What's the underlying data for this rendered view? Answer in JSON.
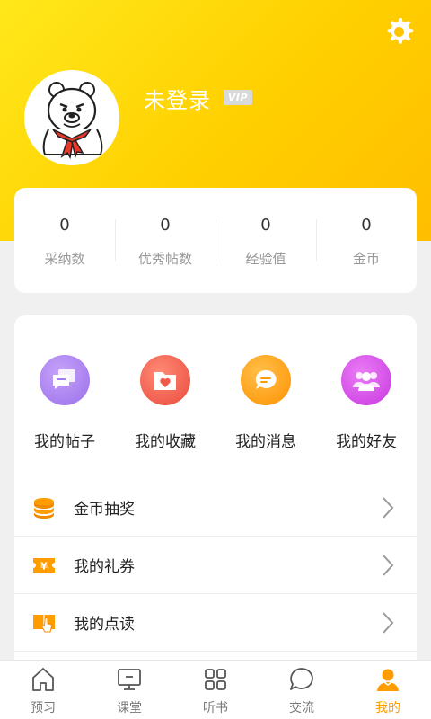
{
  "header": {
    "username": "未登录",
    "vip_badge": "VIP"
  },
  "stats": [
    {
      "value": "0",
      "label": "采纳数"
    },
    {
      "value": "0",
      "label": "优秀帖数"
    },
    {
      "value": "0",
      "label": "经验值"
    },
    {
      "value": "0",
      "label": "金币"
    }
  ],
  "quick_actions": [
    {
      "label": "我的帖子",
      "icon": "chat-bubbles-icon",
      "color": "#a77cf0"
    },
    {
      "label": "我的收藏",
      "icon": "heart-folder-icon",
      "color": "#f05a4a"
    },
    {
      "label": "我的消息",
      "icon": "message-icon",
      "color": "#ff9c00"
    },
    {
      "label": "我的好友",
      "icon": "friends-icon",
      "color": "#d64ae8"
    }
  ],
  "menu": [
    {
      "label": "金币抽奖",
      "icon": "coin-stack-icon"
    },
    {
      "label": "我的礼券",
      "icon": "coupon-icon"
    },
    {
      "label": "我的点读",
      "icon": "book-touch-icon"
    }
  ],
  "tabs": [
    {
      "label": "预习",
      "icon": "home-icon",
      "active": false
    },
    {
      "label": "课堂",
      "icon": "monitor-icon",
      "active": false
    },
    {
      "label": "听书",
      "icon": "grid-icon",
      "active": false
    },
    {
      "label": "交流",
      "icon": "chat-icon",
      "active": false
    },
    {
      "label": "我的",
      "icon": "user-icon",
      "active": true
    }
  ],
  "colors": {
    "accent": "#ff9c00",
    "header_gradient_start": "#ffe81a",
    "header_gradient_end": "#ffbe00"
  }
}
